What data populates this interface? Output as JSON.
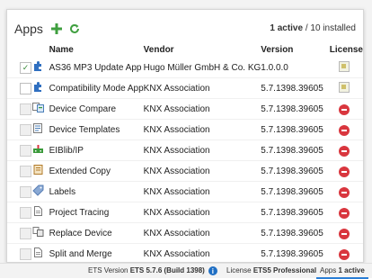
{
  "panel": {
    "title": "Apps",
    "active_count": "1 active",
    "installed": " / 10 installed"
  },
  "table": {
    "headers": {
      "name": "Name",
      "vendor": "Vendor",
      "version": "Version",
      "license": "License"
    },
    "rows": [
      {
        "name": "AS36 MP3 Update App",
        "vendor": "Hugo Müller GmbH & Co. KG",
        "version": "1.0.0.0",
        "checked": true,
        "icon": "puzzle-icon",
        "license": "license-ok"
      },
      {
        "name": "Compatibility Mode App",
        "vendor": "KNX Association",
        "version": "5.7.1398.39605",
        "checked": false,
        "icon": "puzzle-icon",
        "license": "license-ok"
      },
      {
        "name": "Device Compare",
        "vendor": "KNX Association",
        "version": "5.7.1398.39605",
        "checked": false,
        "icon": "compare-icon",
        "license": "license-missing"
      },
      {
        "name": "Device Templates",
        "vendor": "KNX Association",
        "version": "5.7.1398.39605",
        "checked": false,
        "icon": "templates-icon",
        "license": "license-missing"
      },
      {
        "name": "EIBlib/IP",
        "vendor": "KNX Association",
        "version": "5.7.1398.39605",
        "checked": false,
        "icon": "network-icon",
        "license": "license-missing"
      },
      {
        "name": "Extended Copy",
        "vendor": "KNX Association",
        "version": "5.7.1398.39605",
        "checked": false,
        "icon": "copy-icon",
        "license": "license-missing"
      },
      {
        "name": "Labels",
        "vendor": "KNX Association",
        "version": "5.7.1398.39605",
        "checked": false,
        "icon": "label-icon",
        "license": "license-missing"
      },
      {
        "name": "Project Tracing",
        "vendor": "KNX Association",
        "version": "5.7.1398.39605",
        "checked": false,
        "icon": "document-icon",
        "license": "license-missing"
      },
      {
        "name": "Replace Device",
        "vendor": "KNX Association",
        "version": "5.7.1398.39605",
        "checked": false,
        "icon": "replace-icon",
        "license": "license-missing"
      },
      {
        "name": "Split and Merge",
        "vendor": "KNX Association",
        "version": "5.7.1398.39605",
        "checked": false,
        "icon": "document-icon",
        "license": "license-missing"
      }
    ]
  },
  "statusbar": {
    "version_label": "ETS Version",
    "version_value": "ETS 5.7.6 (Build 1398)",
    "license_label": "License",
    "license_value": "ETS5 Professional",
    "apps_label": "Apps",
    "apps_value": "1 active"
  },
  "colors": {
    "add": "#3f9f3f",
    "refresh": "#3f9f3f",
    "accent": "#2a7fd6",
    "license_missing": "#d9363e"
  }
}
